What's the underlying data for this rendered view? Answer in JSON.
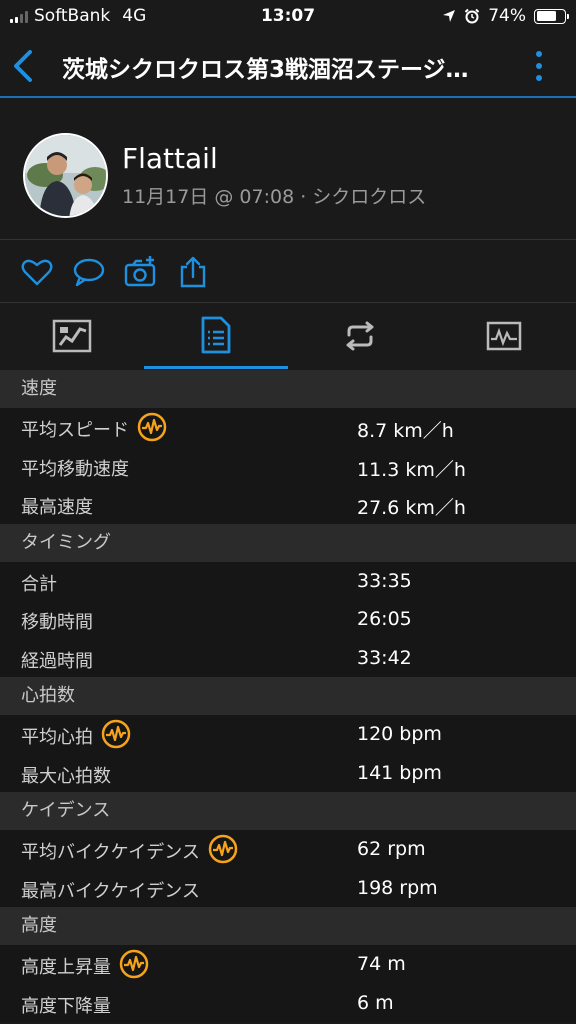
{
  "status_bar": {
    "carrier": "SoftBank",
    "network": "4G",
    "time": "13:07",
    "battery": "74%",
    "battery_level": 0.74
  },
  "nav": {
    "title": "茨城シクロクロス第3戦涸沼ステージ…"
  },
  "activity": {
    "user_name": "Flattail",
    "meta": "11月17日 @ 07:08 · シクロクロス"
  },
  "colors": {
    "accent": "#1f8fe0",
    "badge": "#f5a31a",
    "header_bg": "#2b2b2b",
    "row_bg": "#161616"
  },
  "sections": [
    {
      "title": "速度",
      "rows": [
        {
          "label": "平均スピード",
          "value": "8.7 km／h",
          "badge": true
        },
        {
          "label": "平均移動速度",
          "value": "11.3 km／h",
          "badge": false
        },
        {
          "label": "最高速度",
          "value": "27.6 km／h",
          "badge": false
        }
      ]
    },
    {
      "title": "タイミング",
      "rows": [
        {
          "label": "合計",
          "value": "33:35",
          "badge": false
        },
        {
          "label": "移動時間",
          "value": "26:05",
          "badge": false
        },
        {
          "label": "経過時間",
          "value": "33:42",
          "badge": false
        }
      ]
    },
    {
      "title": "心拍数",
      "rows": [
        {
          "label": "平均心拍",
          "value": "120 bpm",
          "badge": true
        },
        {
          "label": "最大心拍数",
          "value": "141 bpm",
          "badge": false
        }
      ]
    },
    {
      "title": "ケイデンス",
      "rows": [
        {
          "label": "平均バイクケイデンス",
          "value": "62 rpm",
          "badge": true
        },
        {
          "label": "最高バイクケイデンス",
          "value": "198 rpm",
          "badge": false
        }
      ]
    },
    {
      "title": "高度",
      "rows": [
        {
          "label": "高度上昇量",
          "value": "74 m",
          "badge": true
        },
        {
          "label": "高度下降量",
          "value": "6 m",
          "badge": false
        }
      ]
    }
  ]
}
